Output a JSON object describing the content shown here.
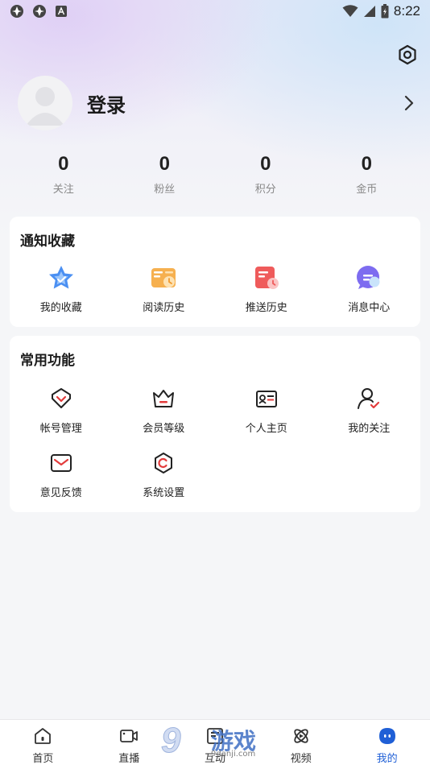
{
  "status_bar": {
    "time": "8:22",
    "left_icons": [
      "notification-icon-1",
      "notification-icon-2",
      "text-icon"
    ],
    "right_icons": [
      "wifi-icon",
      "signal-icon",
      "battery-icon"
    ]
  },
  "header": {
    "settings_icon": "hexagon-settings-icon"
  },
  "profile": {
    "login_label": "登录",
    "arrow_icon": "chevron-right-icon"
  },
  "stats": [
    {
      "value": "0",
      "label": "关注"
    },
    {
      "value": "0",
      "label": "粉丝"
    },
    {
      "value": "0",
      "label": "积分"
    },
    {
      "value": "0",
      "label": "金币"
    }
  ],
  "notify_section": {
    "title": "通知收藏",
    "items": [
      {
        "label": "我的收藏",
        "icon": "star-icon",
        "color": "#3f8cf0"
      },
      {
        "label": "阅读历史",
        "icon": "book-icon",
        "color": "#f5a544"
      },
      {
        "label": "推送历史",
        "icon": "push-history-icon",
        "color": "#ef5b5b"
      },
      {
        "label": "消息中心",
        "icon": "message-icon",
        "color": "#7b6cf0"
      }
    ]
  },
  "common_section": {
    "title": "常用功能",
    "items": [
      {
        "label": "帐号管理",
        "icon": "account-icon"
      },
      {
        "label": "会员等级",
        "icon": "crown-icon"
      },
      {
        "label": "个人主页",
        "icon": "profile-card-icon"
      },
      {
        "label": "我的关注",
        "icon": "follow-icon"
      },
      {
        "label": "意见反馈",
        "icon": "feedback-icon"
      },
      {
        "label": "系统设置",
        "icon": "settings-icon"
      }
    ]
  },
  "bottom_nav": {
    "items": [
      {
        "label": "首页",
        "icon": "home-icon"
      },
      {
        "label": "直播",
        "icon": "live-icon"
      },
      {
        "label": "互动",
        "icon": "interact-icon"
      },
      {
        "label": "视频",
        "icon": "video-icon"
      },
      {
        "label": "我的",
        "icon": "mine-icon",
        "active": true
      }
    ],
    "active_color": "#1f5fd6"
  },
  "watermark": {
    "number": "9",
    "text": "游戏",
    "url": "9danji.com"
  }
}
